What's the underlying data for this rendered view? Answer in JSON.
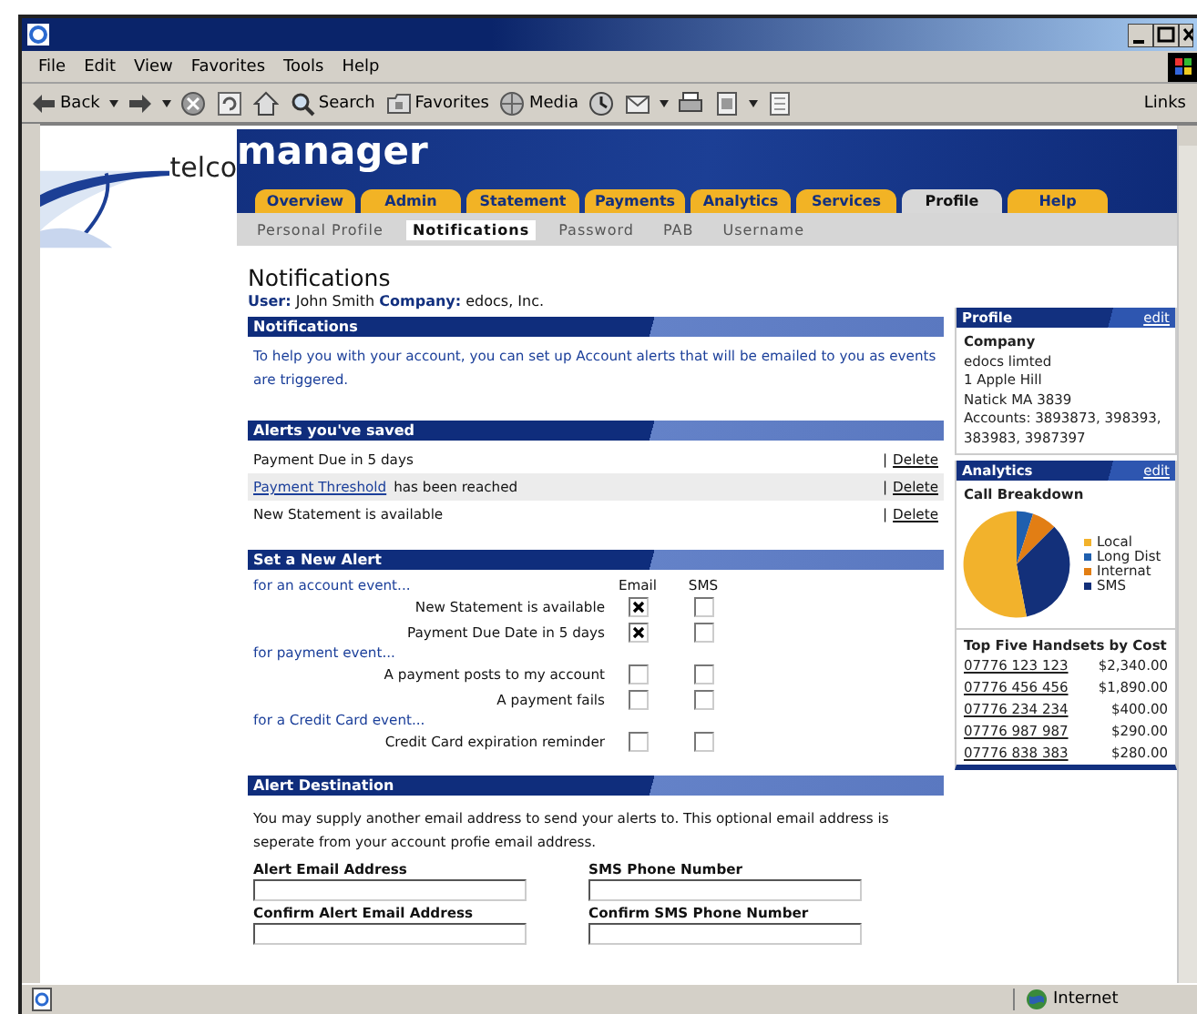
{
  "window": {
    "menu": [
      "File",
      "Edit",
      "View",
      "Favorites",
      "Tools",
      "Help"
    ],
    "toolbar": [
      {
        "kind": "back",
        "label": "Back",
        "caret": true
      },
      {
        "kind": "forward",
        "caret": true
      },
      {
        "kind": "stop"
      },
      {
        "kind": "refresh"
      },
      {
        "kind": "home"
      },
      {
        "kind": "search",
        "label": "Search"
      },
      {
        "kind": "favorites",
        "label": "Favorites"
      },
      {
        "kind": "media",
        "label": "Media"
      },
      {
        "kind": "history"
      },
      {
        "kind": "mail",
        "caret": true
      },
      {
        "kind": "print"
      },
      {
        "kind": "edit",
        "caret": true
      },
      {
        "kind": "discuss"
      }
    ],
    "links": "Links"
  },
  "site": {
    "logo_prefix": "telco",
    "logo_main": "manager",
    "tabs": [
      {
        "label": "Overview",
        "selected": false
      },
      {
        "label": "Admin",
        "selected": false
      },
      {
        "label": "Statement",
        "selected": false
      },
      {
        "label": "Payments",
        "selected": false
      },
      {
        "label": "Analytics",
        "selected": false
      },
      {
        "label": "Services",
        "selected": false
      },
      {
        "label": "Profile",
        "selected": true
      },
      {
        "label": "Help",
        "selected": false
      }
    ],
    "subtabs": [
      {
        "label": "Personal Profile",
        "selected": false
      },
      {
        "label": "Notifications",
        "selected": true
      },
      {
        "label": "Password",
        "selected": false
      },
      {
        "label": "PAB",
        "selected": false
      },
      {
        "label": "Username",
        "selected": false
      }
    ]
  },
  "page": {
    "title": "Notifications",
    "user_line": "**User:** John Smith  **Company:** edocs, Inc."
  },
  "notifications": {
    "heading": "Notifications",
    "text": "To help you with your account, you can set up Account alerts that will be  emailed to you as events are triggered."
  },
  "saved_alerts": {
    "heading": "Alerts you've saved",
    "rows": [
      {
        "text": "Payment Due in 5 days",
        "separator": "|",
        "action": "Delete"
      },
      {
        "link": "Payment Threshold",
        "text": "has been reached",
        "separator": "|",
        "action": "Delete"
      },
      {
        "text": "New Statement is available",
        "separator": "|",
        "action": "Delete"
      }
    ]
  },
  "new_alert": {
    "heading": "Set a New Alert",
    "columns": [
      "Email",
      "SMS"
    ],
    "groups": [
      {
        "title": "for an account event...",
        "items": [
          {
            "label": "New Statement is available",
            "email": true,
            "sms": false
          },
          {
            "label": "Payment Due Date in 5 days",
            "email": true,
            "sms": false
          }
        ]
      },
      {
        "title": "for payment event...",
        "items": [
          {
            "label": "A payment posts to my account",
            "email": false,
            "sms": false
          },
          {
            "label": "A payment fails",
            "email": false,
            "sms": false
          }
        ]
      },
      {
        "title": "for a Credit Card event...",
        "items": [
          {
            "label": "Credit Card expiration reminder",
            "email": false,
            "sms": false
          }
        ]
      }
    ]
  },
  "destination": {
    "heading": "Alert Destination",
    "text": "You may supply another email address to send your alerts to. This optional email address is seperate from your account profie email address.",
    "fields": [
      {
        "label": "Alert Email Address"
      },
      {
        "label": "SMS Phone Number"
      },
      {
        "label": "Confirm Alert Email Address"
      },
      {
        "label": "Confirm SMS Phone Number"
      }
    ]
  },
  "profile": {
    "heading": "Profile",
    "edit": "edit",
    "company_label": "Company",
    "lines": [
      "edocs limted",
      "1 Apple Hill",
      "Natick MA 3839",
      "Accounts: 3893873, 398393, 383983, 3987397"
    ]
  },
  "analytics": {
    "heading": "Analytics",
    "edit": "edit",
    "chart_title": "Call Breakdown",
    "legend": [
      {
        "label": "Local",
        "color": "#f2b22c"
      },
      {
        "label": "Long Dist",
        "color": "#1f5fae"
      },
      {
        "label": "Internat",
        "color": "#e27e14"
      },
      {
        "label": "SMS",
        "color": "#13307a"
      }
    ],
    "handsets_title": "Top Five Handsets by Cost",
    "handsets": [
      {
        "number": "07776 123 123",
        "cost": "$2,340.00"
      },
      {
        "number": "07776 456 456",
        "cost": "$1,890.00"
      },
      {
        "number": "07776 234 234",
        "cost": "$400.00"
      },
      {
        "number": "07776 987 987",
        "cost": "$290.00"
      },
      {
        "number": "07776 838 383",
        "cost": "$280.00"
      }
    ]
  },
  "status_bar": {
    "zone": "Internet"
  }
}
